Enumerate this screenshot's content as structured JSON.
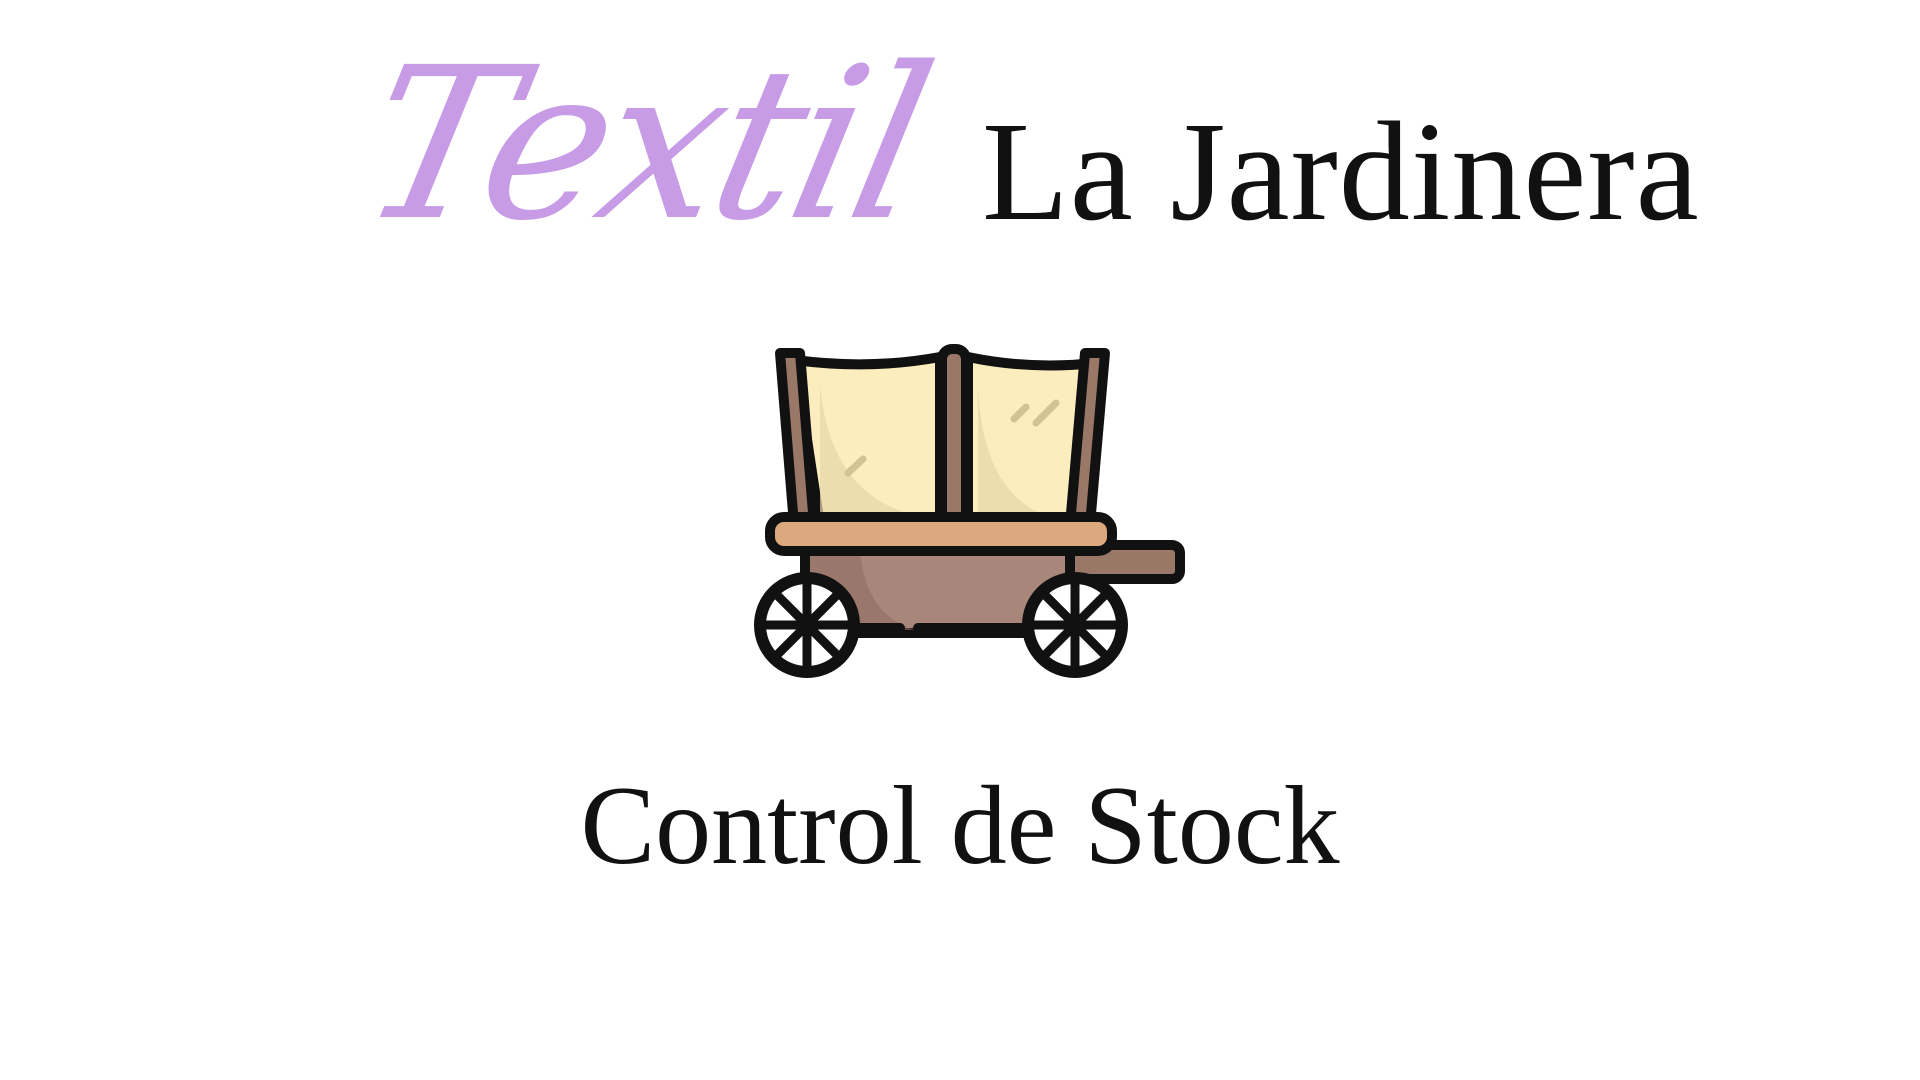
{
  "brand": {
    "script_word": "Textil",
    "name": "La Jardinera",
    "script_color": "#c79be6"
  },
  "logo": {
    "icon": "covered-wagon-icon"
  },
  "subtitle": "Control de Stock",
  "colors": {
    "background": "#ffffff",
    "text": "#111111",
    "canvas": "#fbedbd",
    "wood_light": "#dca97e",
    "wood_dark": "#9a7867",
    "outline": "#111111"
  }
}
